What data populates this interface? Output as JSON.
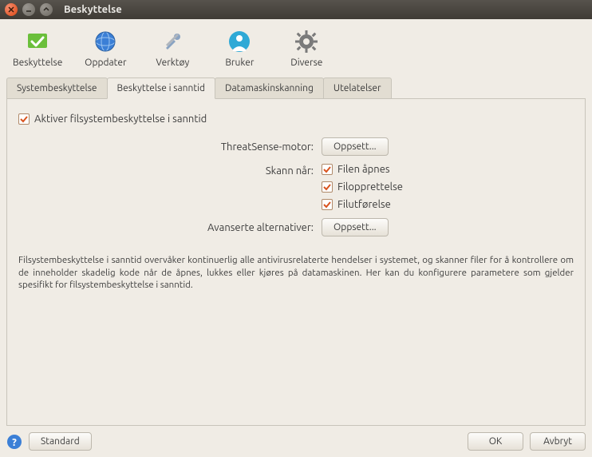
{
  "window": {
    "title": "Beskyttelse"
  },
  "toolbar": {
    "items": [
      {
        "label": "Beskyttelse"
      },
      {
        "label": "Oppdater"
      },
      {
        "label": "Verktøy"
      },
      {
        "label": "Bruker"
      },
      {
        "label": "Diverse"
      }
    ]
  },
  "tabs": [
    {
      "label": "Systembeskyttelse"
    },
    {
      "label": "Beskyttelse i sanntid"
    },
    {
      "label": "Datamaskinskanning"
    },
    {
      "label": "Utelatelser"
    }
  ],
  "panel": {
    "enable_label": "Aktiver filsystembeskyttelse i sanntid",
    "engine_label": "ThreatSense-motor:",
    "engine_button": "Oppsett...",
    "scan_label": "Skann når:",
    "scan_options": [
      "Filen åpnes",
      "Filopprettelse",
      "Filutførelse"
    ],
    "advanced_label": "Avanserte alternativer:",
    "advanced_button": "Oppsett...",
    "description": "Filsystembeskyttelse i sanntid overvåker kontinuerlig alle antivirusrelaterte hendelser i systemet, og skanner filer for å kontrollere om de inneholder skadelig kode når de åpnes, lukkes eller kjøres på datamaskinen. Her kan du konfigurere parametere som gjelder spesifikt for filsystembeskyttelse i sanntid."
  },
  "footer": {
    "standard": "Standard",
    "ok": "OK",
    "cancel": "Avbryt"
  }
}
